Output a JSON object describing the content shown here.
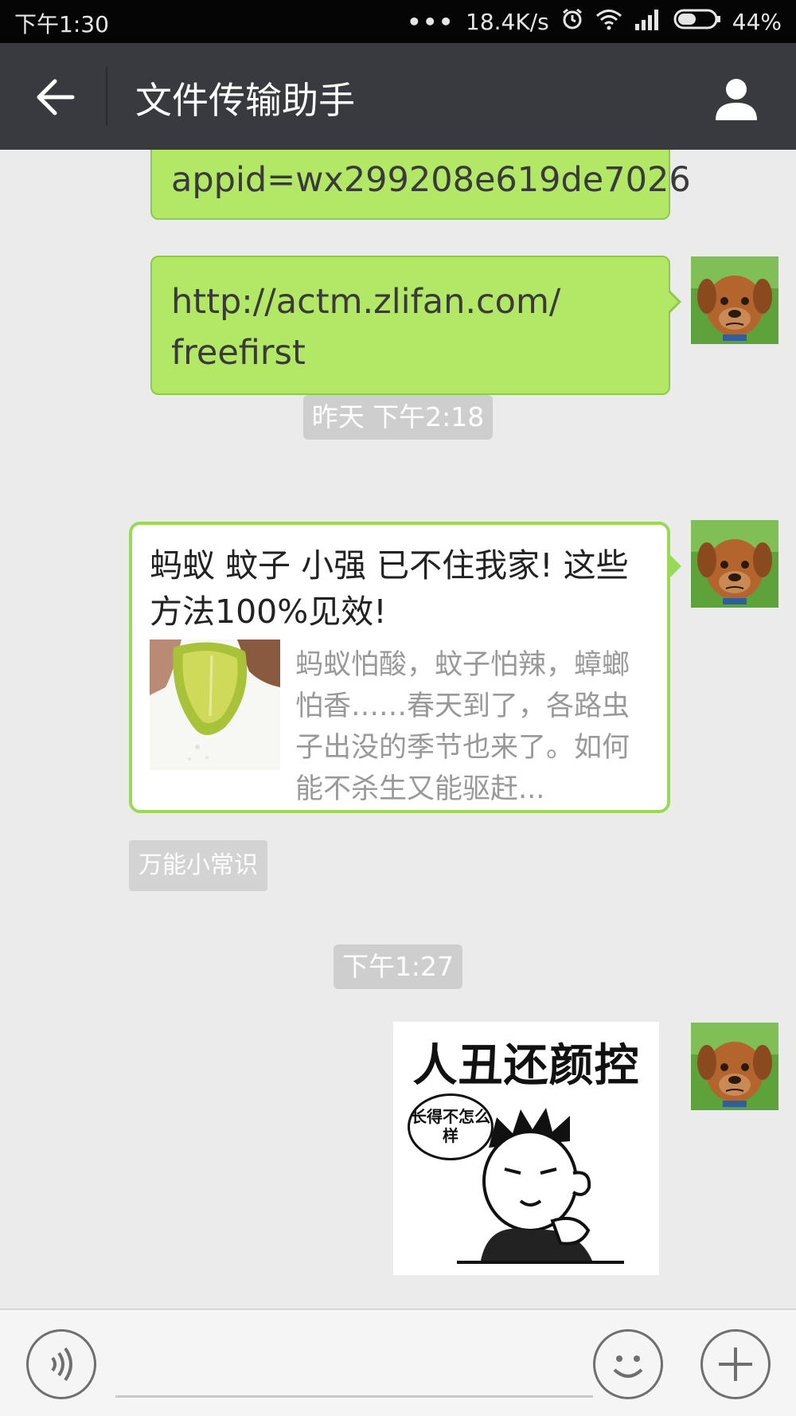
{
  "status_bar": {
    "time": "下午1:30",
    "dots": "•••",
    "net_speed": "18.4K/s",
    "battery": "44%"
  },
  "header": {
    "title": "文件传输助手"
  },
  "messages": {
    "m1_text": "appid=wx299208e619de7026",
    "m2_line1": "http://actm.zlifan.com/",
    "m2_line2": "freefirst",
    "time1": "昨天 下午2:18",
    "card_title": "蚂蚁 蚊子 小强 已不住我家! 这些方法100%见效!",
    "card_desc": "蚂蚁怕酸，蚊子怕辣，蟑螂怕香……春天到了，各路虫子出没的季节也来了。如何能不杀生又能驱赶...",
    "card_source": "万能小常识",
    "time2": "下午1:27",
    "meme_title": "人丑还颜控",
    "meme_bubble": "长得不怎么样"
  },
  "colors": {
    "header_bg": "#393a3f",
    "bubble_green": "#b2e866",
    "chat_bg": "#ebebeb"
  }
}
